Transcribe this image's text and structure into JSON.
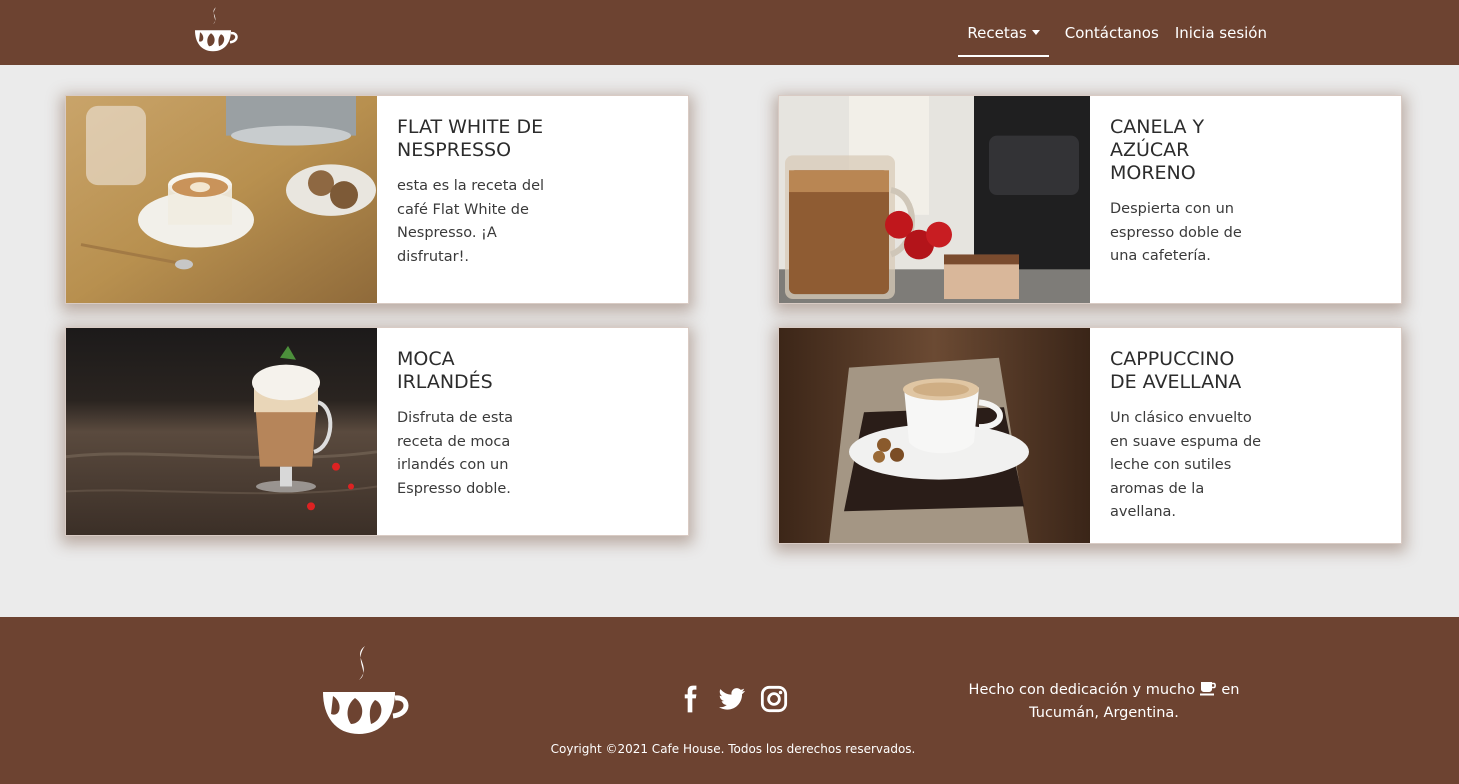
{
  "nav": {
    "logo_icon": "coffee-cup-logo-icon",
    "links": [
      {
        "label": "Recetas",
        "dropdown": true,
        "active": true
      },
      {
        "label": "Contáctanos"
      },
      {
        "label": "Inicia sesión"
      }
    ]
  },
  "cards": [
    {
      "title_line1": "FLAT WHITE DE",
      "title_line2": "NESPRESSO",
      "title_line3": "",
      "text": [
        "esta es la receta del",
        "café Flat White de",
        "Nespresso. ¡A",
        "disfrutar!."
      ],
      "image": "flat-white-photo"
    },
    {
      "title_line1": "CANELA Y",
      "title_line2": "AZÚCAR",
      "title_line3": "MORENO",
      "text": [
        "Despierta con un",
        "espresso doble de",
        "una cafetería."
      ],
      "image": "cinnamon-coffee-photo"
    },
    {
      "title_line1": "MOCA",
      "title_line2": "IRLANDÉS",
      "title_line3": "",
      "text": [
        "Disfruta de esta",
        "receta de moca",
        "irlandés con un",
        "Espresso doble."
      ],
      "image": "irish-mocha-photo"
    },
    {
      "title_line1": "CAPPUCCINO",
      "title_line2": "DE AVELLANA",
      "title_line3": "",
      "text": [
        "Un clásico envuelto",
        "en suave espuma de",
        "leche con sutiles",
        "aromas de la",
        "avellana."
      ],
      "image": "hazelnut-cappuccino-photo"
    }
  ],
  "footer": {
    "logo_icon": "coffee-cup-logo-icon",
    "social": [
      "facebook-icon",
      "twitter-icon",
      "instagram-icon"
    ],
    "made_with_before": "Hecho con dedicación y mucho",
    "made_with_icon": "coffee-mug-icon",
    "made_with_after": "en",
    "made_with_line2": "Tucumán, Argentina.",
    "copyright": "Coyright ©2021 Cafe House. Todos los derechos reservados."
  },
  "colors": {
    "brand_brown": "#6d4331",
    "page_background": "#ebebeb",
    "card_background": "#ffffff"
  }
}
